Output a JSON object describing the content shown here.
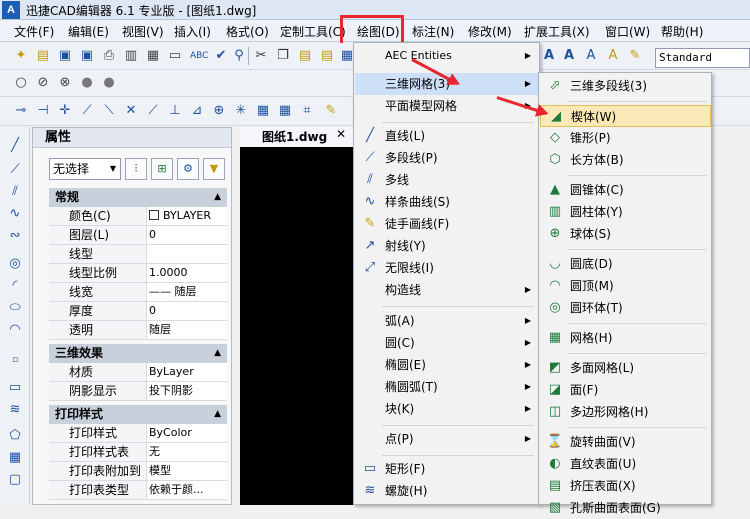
{
  "title": {
    "app_logo": "A",
    "text": "迅捷CAD编辑器 6.1 专业版  - [图纸1.dwg]"
  },
  "menubar": [
    "文件(F)",
    "编辑(E)",
    "视图(V)",
    "插入(I)",
    "格式(O)",
    "定制工具(C)",
    "绘图(D)",
    "标注(N)",
    "修改(M)",
    "扩展工具(X)",
    "窗口(W)",
    "帮助(H)"
  ],
  "toolbar": {
    "style_value": "Standard"
  },
  "properties": {
    "title": "属性",
    "selection": "无选择",
    "sections": [
      {
        "name": "常规",
        "rows": [
          {
            "key": "颜色(C)",
            "value": "BYLAYER"
          },
          {
            "key": "图层(L)",
            "value": "0"
          },
          {
            "key": "线型",
            "value": ""
          },
          {
            "key": "线型比例",
            "value": "1.0000"
          },
          {
            "key": "线宽",
            "value": "—— 随层"
          },
          {
            "key": "厚度",
            "value": "0"
          },
          {
            "key": "透明",
            "value": "随层"
          }
        ]
      },
      {
        "name": "三维效果",
        "rows": [
          {
            "key": "材质",
            "value": "ByLayer"
          },
          {
            "key": "阴影显示",
            "value": "投下阴影"
          }
        ]
      },
      {
        "name": "打印样式",
        "rows": [
          {
            "key": "打印样式",
            "value": "ByColor"
          },
          {
            "key": "打印样式表",
            "value": "无"
          },
          {
            "key": "打印表附加到",
            "value": "模型"
          },
          {
            "key": "打印表类型",
            "value": "依赖于颜..."
          }
        ]
      }
    ]
  },
  "document": {
    "tab": "图纸1.dwg",
    "close": "✕"
  },
  "draw_menu": [
    "AEC Entities",
    "三维网格(3)",
    "平面模型网格",
    "直线(L)",
    "多段线(P)",
    "多线",
    "样条曲线(S)",
    "徒手画线(F)",
    "射线(Y)",
    "无限线(I)",
    "构造线",
    "弧(A)",
    "圆(C)",
    "椭圆(E)",
    "椭圆弧(T)",
    "块(K)",
    "点(P)",
    "矩形(F)",
    "螺旋(H)"
  ],
  "mesh_menu": [
    "三维多段线(3)",
    "楔体(W)",
    "锥形(P)",
    "长方体(B)",
    "圆锥体(C)",
    "圆柱体(Y)",
    "球体(S)",
    "圆底(D)",
    "圆顶(M)",
    "圆环体(T)",
    "网格(H)",
    "多面网格(L)",
    "面(F)",
    "多边形网格(H)",
    "旋转曲面(V)",
    "直纹表面(U)",
    "挤压表面(X)",
    "孔斯曲面表面(G)"
  ]
}
